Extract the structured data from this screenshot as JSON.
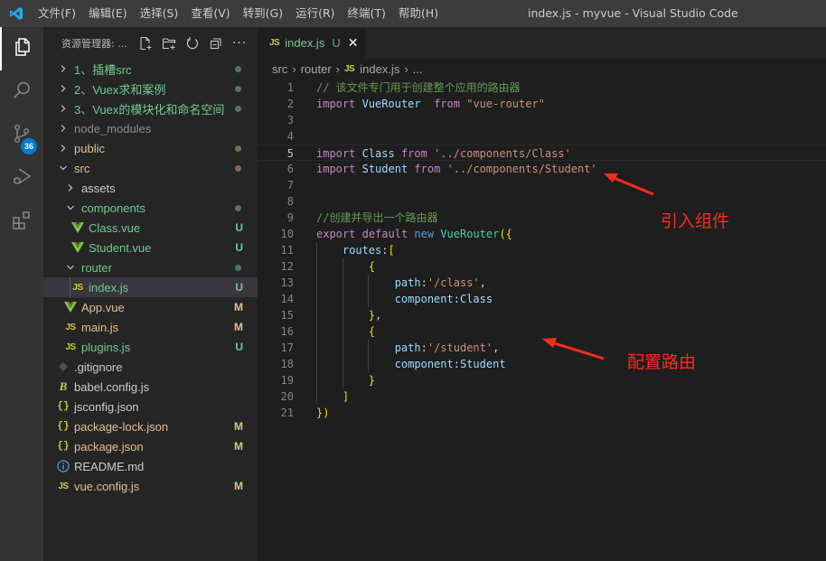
{
  "titlebar": {
    "menu": [
      "文件(F)",
      "编辑(E)",
      "选择(S)",
      "查看(V)",
      "转到(G)",
      "运行(R)",
      "终端(T)",
      "帮助(H)"
    ],
    "window_title": "index.js - myvue - Visual Studio Code"
  },
  "activitybar": {
    "items": [
      {
        "name": "explorer",
        "icon": "files-icon",
        "active": true
      },
      {
        "name": "search",
        "icon": "search-icon"
      },
      {
        "name": "source-control",
        "icon": "source-control-icon",
        "badge": "36"
      },
      {
        "name": "run-debug",
        "icon": "run-debug-icon"
      },
      {
        "name": "extensions",
        "icon": "extensions-icon"
      }
    ]
  },
  "sidebar": {
    "title": "资源管理器: ...",
    "actions": [
      "new-file-icon",
      "new-folder-icon",
      "refresh-icon",
      "collapse-all-icon",
      "more-icon"
    ],
    "tree": [
      {
        "label": "1、插槽src",
        "type": "folder",
        "expanded": false,
        "depth": 0,
        "color": "green",
        "decoration": "dot"
      },
      {
        "label": "2、Vuex求和案例",
        "type": "folder",
        "expanded": false,
        "depth": 0,
        "color": "green",
        "decoration": "dot"
      },
      {
        "label": "3、Vuex的模块化和命名空间",
        "type": "folder",
        "expanded": false,
        "depth": 0,
        "color": "green",
        "decoration": "dot"
      },
      {
        "label": "node_modules",
        "type": "folder",
        "expanded": false,
        "depth": 0,
        "color": "grey",
        "decoration": ""
      },
      {
        "label": "public",
        "type": "folder",
        "expanded": false,
        "depth": 0,
        "color": "mod",
        "decoration": "dot"
      },
      {
        "label": "src",
        "type": "folder",
        "expanded": true,
        "depth": 0,
        "color": "mod",
        "decoration": "dot"
      },
      {
        "label": "assets",
        "type": "folder",
        "expanded": false,
        "depth": 1,
        "color": "norm",
        "decoration": ""
      },
      {
        "label": "components",
        "type": "folder",
        "expanded": true,
        "depth": 1,
        "color": "green",
        "decoration": "dot"
      },
      {
        "label": "Class.vue",
        "type": "vue",
        "depth": 2,
        "color": "green",
        "decoration": "U"
      },
      {
        "label": "Student.vue",
        "type": "vue",
        "depth": 2,
        "color": "green",
        "decoration": "U"
      },
      {
        "label": "router",
        "type": "folder",
        "expanded": true,
        "depth": 1,
        "color": "green",
        "decoration": "dot"
      },
      {
        "label": "index.js",
        "type": "js",
        "depth": 2,
        "color": "green",
        "decoration": "U",
        "selected": true
      },
      {
        "label": "App.vue",
        "type": "vue",
        "depth": 1,
        "color": "mod",
        "decoration": "M"
      },
      {
        "label": "main.js",
        "type": "js",
        "depth": 1,
        "color": "mod",
        "decoration": "M"
      },
      {
        "label": "plugins.js",
        "type": "js",
        "depth": 1,
        "color": "green",
        "decoration": "U"
      },
      {
        "label": ".gitignore",
        "type": "git",
        "depth": 0,
        "color": "norm",
        "decoration": ""
      },
      {
        "label": "babel.config.js",
        "type": "babel",
        "depth": 0,
        "color": "norm",
        "decoration": ""
      },
      {
        "label": "jsconfig.json",
        "type": "json",
        "depth": 0,
        "color": "norm",
        "decoration": ""
      },
      {
        "label": "package-lock.json",
        "type": "json",
        "depth": 0,
        "color": "mod",
        "decoration": "M"
      },
      {
        "label": "package.json",
        "type": "json",
        "depth": 0,
        "color": "mod",
        "decoration": "M"
      },
      {
        "label": "README.md",
        "type": "info",
        "depth": 0,
        "color": "norm",
        "decoration": ""
      },
      {
        "label": "vue.config.js",
        "type": "js",
        "depth": 0,
        "color": "mod",
        "decoration": "M"
      }
    ]
  },
  "editor": {
    "tab": {
      "icon": "JS",
      "label": "index.js",
      "status": "U",
      "close": "✕"
    },
    "breadcrumbs": [
      "src",
      "router",
      "index.js",
      "..."
    ],
    "current_line": 5,
    "lines": [
      [
        [
          "cm",
          "// 该文件专门用于创建整个应用的路由器"
        ]
      ],
      [
        [
          "kw",
          "import"
        ],
        [
          "pn",
          " "
        ],
        [
          "id",
          "VueRouter"
        ],
        [
          "pn",
          "  "
        ],
        [
          "kw",
          "from"
        ],
        [
          "pn",
          " "
        ],
        [
          "str",
          "\"vue-router\""
        ]
      ],
      [],
      [],
      [
        [
          "kw",
          "import"
        ],
        [
          "pn",
          " "
        ],
        [
          "id",
          "Class"
        ],
        [
          "pn",
          " "
        ],
        [
          "kw",
          "from"
        ],
        [
          "pn",
          " "
        ],
        [
          "str",
          "'../components/Class'"
        ]
      ],
      [
        [
          "kw",
          "import"
        ],
        [
          "pn",
          " "
        ],
        [
          "id",
          "Student"
        ],
        [
          "pn",
          " "
        ],
        [
          "kw",
          "from"
        ],
        [
          "pn",
          " "
        ],
        [
          "str",
          "'../components/Student'"
        ]
      ],
      [],
      [],
      [
        [
          "cm",
          "//创建并导出一个路由器"
        ]
      ],
      [
        [
          "kw",
          "export"
        ],
        [
          "pn",
          " "
        ],
        [
          "kw",
          "default"
        ],
        [
          "pn",
          " "
        ],
        [
          "kw2",
          "new"
        ],
        [
          "pn",
          " "
        ],
        [
          "cls",
          "VueRouter"
        ],
        [
          "br",
          "({"
        ]
      ],
      [
        [
          "pn",
          "    "
        ],
        [
          "id",
          "routes"
        ],
        [
          "pn",
          ":"
        ],
        [
          "br",
          "["
        ]
      ],
      [
        [
          "pn",
          "        "
        ],
        [
          "br",
          "{"
        ]
      ],
      [
        [
          "pn",
          "            "
        ],
        [
          "id",
          "path"
        ],
        [
          "pn",
          ":"
        ],
        [
          "str",
          "'/class'"
        ],
        [
          "pn",
          ","
        ]
      ],
      [
        [
          "pn",
          "            "
        ],
        [
          "id",
          "component"
        ],
        [
          "pn",
          ":"
        ],
        [
          "id",
          "Class"
        ]
      ],
      [
        [
          "pn",
          "        "
        ],
        [
          "br",
          "}"
        ],
        [
          "pn",
          ","
        ]
      ],
      [
        [
          "pn",
          "        "
        ],
        [
          "br",
          "{"
        ]
      ],
      [
        [
          "pn",
          "            "
        ],
        [
          "id",
          "path"
        ],
        [
          "pn",
          ":"
        ],
        [
          "str",
          "'/student'"
        ],
        [
          "pn",
          ","
        ]
      ],
      [
        [
          "pn",
          "            "
        ],
        [
          "id",
          "component"
        ],
        [
          "pn",
          ":"
        ],
        [
          "id",
          "Student"
        ]
      ],
      [
        [
          "pn",
          "        "
        ],
        [
          "br",
          "}"
        ]
      ],
      [
        [
          "pn",
          "    "
        ],
        [
          "br",
          "]"
        ]
      ],
      [
        [
          "br",
          "})"
        ]
      ]
    ]
  },
  "annotations": {
    "import_components": "引入组件",
    "configure_routes": "配置路由",
    "color": "#ff2a1a"
  }
}
